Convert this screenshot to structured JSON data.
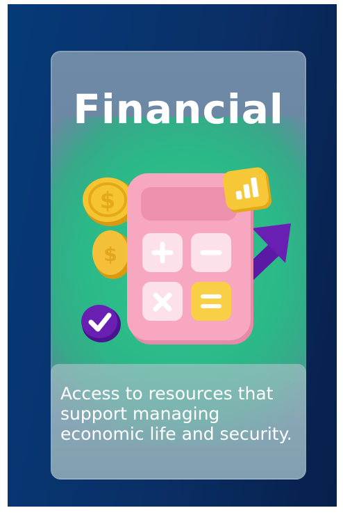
{
  "card": {
    "title": "Financial",
    "description": "Access to resources that support managing economic life and security."
  },
  "icons": [
    "coin-icon",
    "calculator-icon",
    "bar-chart-badge-icon",
    "trend-arrow-icon",
    "checkmark-badge-icon"
  ],
  "colors": {
    "background": "#0a2f67",
    "card": "#6f8aa7",
    "glow": "#2fc68f",
    "calculator": "#f5a3bd",
    "coin": "#f6c430",
    "arrow": "#6a1fb3"
  }
}
